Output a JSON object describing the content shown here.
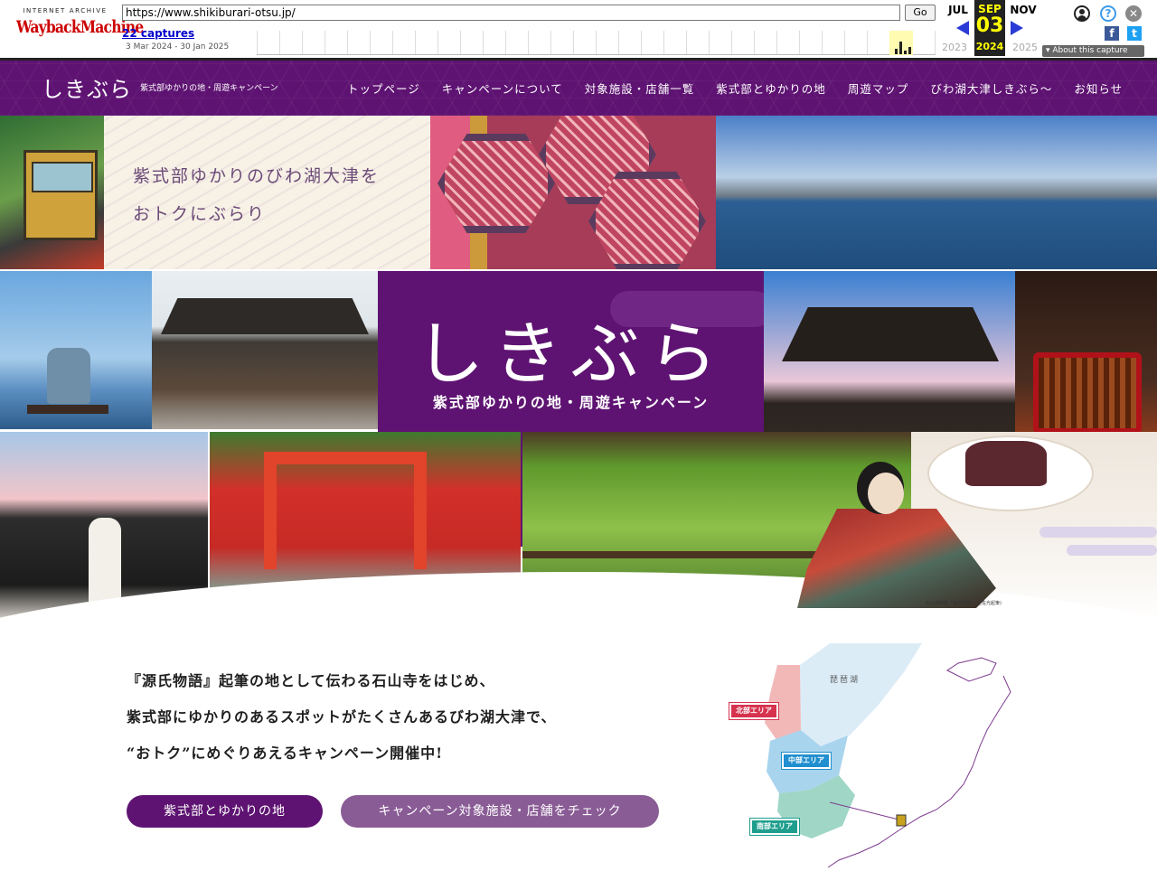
{
  "wayback": {
    "logo_top": "INTERNET ARCHIVE",
    "logo_main": "WaybackMachine",
    "url": "https://www.shikiburari-otsu.jp/",
    "go_label": "Go",
    "captures_label": "22 captures",
    "date_range": "3 Mar 2024 - 30 Jan 2025",
    "prev_month": "JUL",
    "current_month": "SEP",
    "next_month": "NOV",
    "current_day": "03",
    "prev_year": "2023",
    "current_year": "2024",
    "next_year": "2025",
    "about_label": "About this capture",
    "icons": [
      "user-icon",
      "help-icon",
      "close-icon",
      "facebook-icon",
      "twitter-icon"
    ]
  },
  "site": {
    "logo_main": "しきぶら",
    "logo_sub": "紫式部ゆかりの地・周遊キャンペーン",
    "nav": [
      "トップページ",
      "キャンペーンについて",
      "対象施設・店舗一覧",
      "紫式部とゆかりの地",
      "周遊マップ",
      "びわ湖大津しきぶら～",
      "お知らせ"
    ],
    "accent_color": "#5e1372"
  },
  "hero": {
    "copy_line1": "紫式部ゆかりのびわ湖大津を",
    "copy_line2": "おトクにぶらり",
    "title_mark": "しきぶら",
    "title_sub": "紫式部ゆかりの地・周遊キャンペーン",
    "credit": "石山寺所蔵「紫式部図」(土佐光起筆)"
  },
  "intro": {
    "lines": [
      "『源氏物語』起筆の地として伝わる石山寺をはじめ、",
      "紫式部にゆかりのあるスポットがたくさんあるびわ湖大津で、",
      "“おトク”にめぐりあえるキャンペーン開催中!"
    ],
    "button_primary": "紫式部とゆかりの地",
    "button_secondary": "キャンペーン対象施設・店舗をチェック"
  },
  "map": {
    "lake_label": "琵琶湖",
    "north_label": "北部エリア",
    "central_label": "中部エリア",
    "south_label": "南部エリア",
    "colors": {
      "north": "#f2b8b8",
      "central": "#a8d4ee",
      "south": "#9fd6c6",
      "lake": "#dcecf7"
    }
  }
}
